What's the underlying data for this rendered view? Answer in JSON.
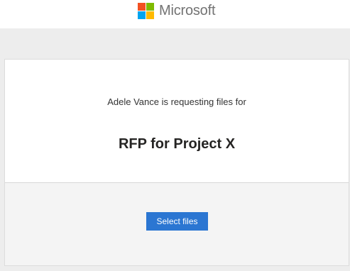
{
  "brand": {
    "name": "Microsoft",
    "logo_colors": [
      "#f25022",
      "#7fba00",
      "#00a4ef",
      "#ffb900"
    ]
  },
  "request": {
    "message": "Adele Vance is requesting files for",
    "title": "RFP for Project X"
  },
  "actions": {
    "select_files_label": "Select files",
    "button_color": "#2b76d2"
  }
}
